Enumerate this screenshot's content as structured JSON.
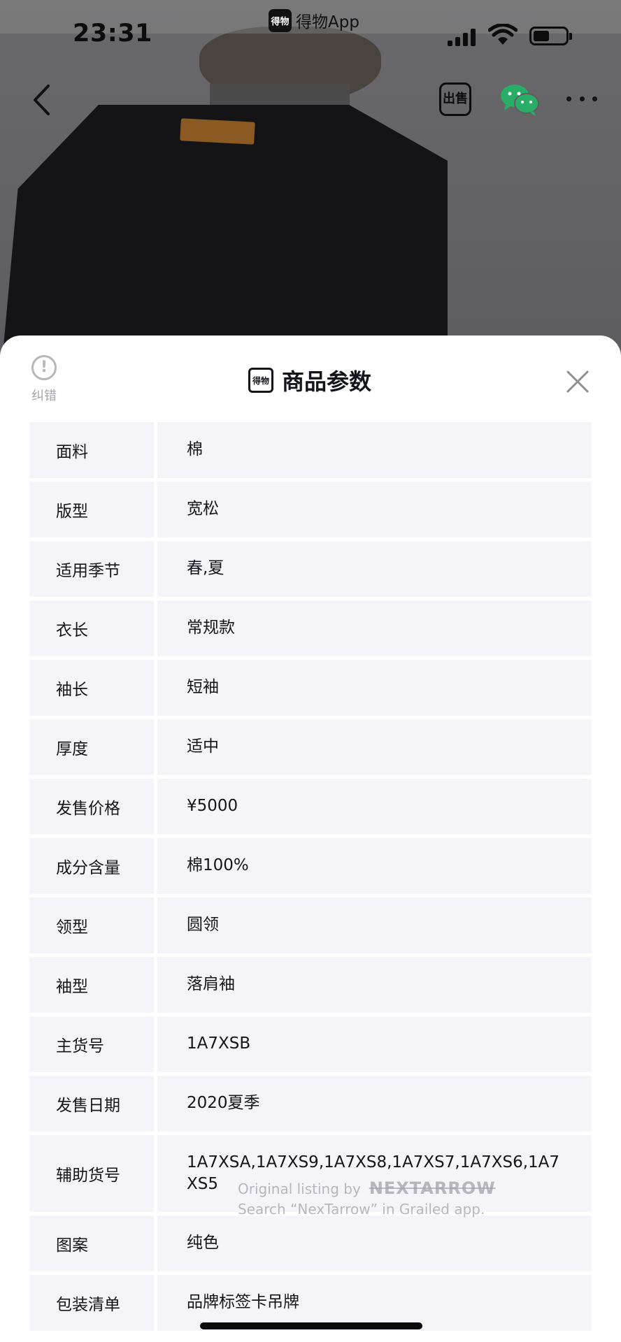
{
  "status_bar": {
    "time": "23:31",
    "app_name": "得物App",
    "app_logo_text": "得物"
  },
  "nav": {
    "sell_label": "出售",
    "icons": [
      "back-chevron-icon",
      "sell-icon",
      "wechat-icon",
      "more-icon"
    ]
  },
  "sheet": {
    "title": "商品参数",
    "title_logo_text": "得物",
    "report_label": "纠错"
  },
  "params": [
    {
      "key": "面料",
      "value": "棉"
    },
    {
      "key": "版型",
      "value": "宽松"
    },
    {
      "key": "适用季节",
      "value": "春,夏"
    },
    {
      "key": "衣长",
      "value": "常规款"
    },
    {
      "key": "袖长",
      "value": "短袖"
    },
    {
      "key": "厚度",
      "value": "适中"
    },
    {
      "key": "发售价格",
      "value": "¥5000"
    },
    {
      "key": "成分含量",
      "value": "棉100%"
    },
    {
      "key": "领型",
      "value": "圆领"
    },
    {
      "key": "袖型",
      "value": "落肩袖"
    },
    {
      "key": "主货号",
      "value": "1A7XSB"
    },
    {
      "key": "发售日期",
      "value": "2020夏季"
    },
    {
      "key": "辅助货号",
      "value": "1A7XSA,1A7XS9,1A7XS8,1A7XS7,1A7XS6,1A7XS5"
    },
    {
      "key": "图案",
      "value": "纯色"
    },
    {
      "key": "包装清单",
      "value": "品牌标签卡吊牌"
    }
  ],
  "watermark": {
    "line1_prefix": "Original listing by",
    "line1_brand": "NEXTARROW",
    "line2": "Search “NexTarrow” in Grailed app."
  },
  "colors": {
    "cell_bg": "#f5f5f9",
    "text": "#14151a",
    "muted": "#a6a6ac"
  }
}
